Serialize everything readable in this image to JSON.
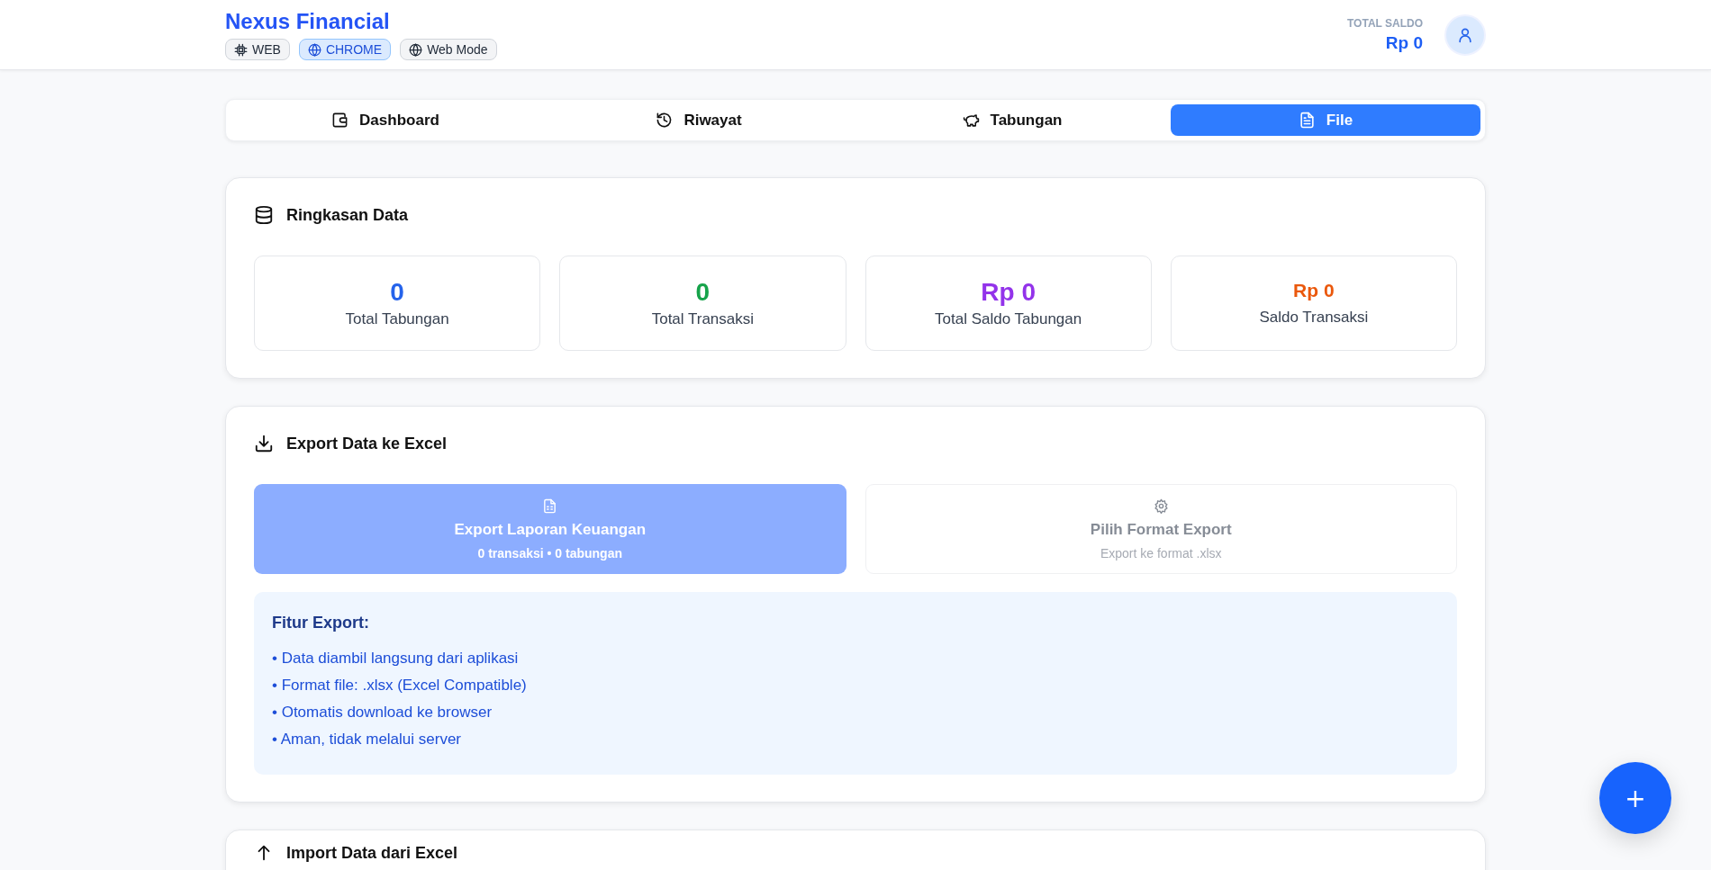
{
  "header": {
    "title": "Nexus Financial",
    "badges": [
      {
        "label": "WEB",
        "kind": "chip",
        "selected": false
      },
      {
        "label": "CHROME",
        "kind": "globe",
        "selected": true
      },
      {
        "label": "Web Mode",
        "kind": "globe",
        "selected": false
      }
    ],
    "balance_label": "TOTAL SALDO",
    "balance_value": "Rp 0"
  },
  "tabs": [
    {
      "label": "Dashboard",
      "kind": "wallet",
      "selected": false
    },
    {
      "label": "Riwayat",
      "kind": "history",
      "selected": false
    },
    {
      "label": "Tabungan",
      "kind": "piggy",
      "selected": false
    },
    {
      "label": "File",
      "kind": "file",
      "selected": true
    }
  ],
  "summary": {
    "title": "Ringkasan Data",
    "stats": [
      {
        "value": "0",
        "label": "Total Tabungan",
        "color": "#2563eb",
        "kind": "large"
      },
      {
        "value": "0",
        "label": "Total Transaksi",
        "color": "#16a34a",
        "kind": "large"
      },
      {
        "value": "Rp 0",
        "label": "Total Saldo Tabungan",
        "color": "#9333ea",
        "kind": "large"
      },
      {
        "value": "Rp 0",
        "label": "Saldo Transaksi",
        "color": "#ea580c",
        "kind": "small"
      }
    ]
  },
  "export": {
    "title": "Export Data ke Excel",
    "actions": [
      {
        "kind": "primary",
        "title": "Export Laporan Keuangan",
        "subtitle": "0 transaksi • 0 tabungan",
        "disabled": true
      },
      {
        "kind": "secondary",
        "title": "Pilih Format Export",
        "subtitle": "Export ke format .xlsx",
        "disabled": true
      }
    ],
    "info": {
      "title": "Fitur Export:",
      "items": [
        "• Data diambil langsung dari aplikasi",
        "• Format file: .xlsx (Excel Compatible)",
        "• Otomatis download ke browser",
        "• Aman, tidak melalui server"
      ]
    }
  },
  "import": {
    "title": "Import Data dari Excel"
  },
  "fab": {
    "label": "+"
  }
}
